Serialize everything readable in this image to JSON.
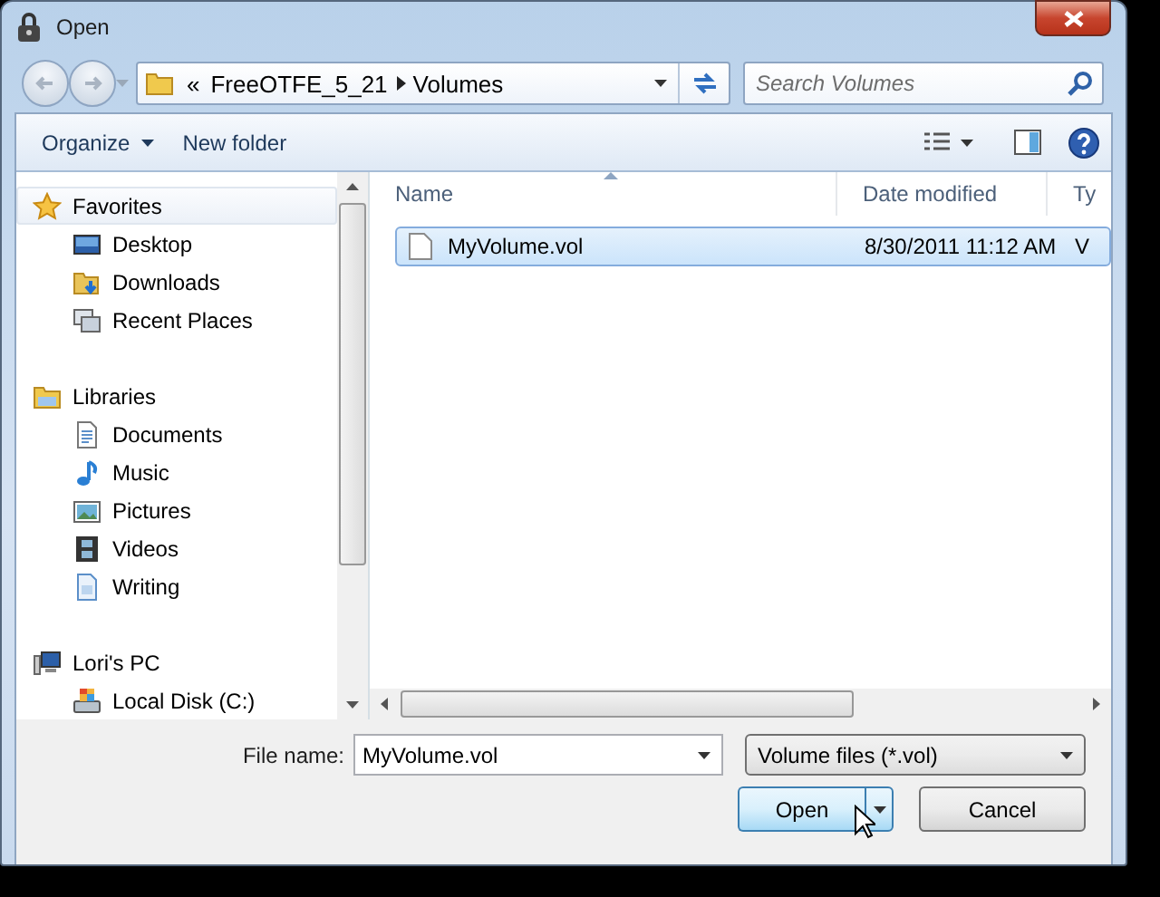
{
  "window": {
    "title": "Open"
  },
  "nav_buttons": [
    {
      "kind": "back",
      "disabled": true
    },
    {
      "kind": "forward",
      "disabled": true
    }
  ],
  "address": {
    "crumbs": [
      "«",
      "FreeOTFE_5_21",
      "Volumes"
    ]
  },
  "search": {
    "placeholder": "Search Volumes"
  },
  "toolbar": {
    "buttons": [
      {
        "label": "Organize",
        "dropdown": true
      },
      {
        "label": "New folder",
        "dropdown": false
      }
    ]
  },
  "navigation": [
    {
      "label": "Favorites",
      "selected": true,
      "children": [
        {
          "label": "Desktop",
          "selected": false
        },
        {
          "label": "Downloads",
          "selected": false
        },
        {
          "label": "Recent Places",
          "selected": false
        }
      ]
    },
    {
      "label": "Libraries",
      "selected": false,
      "children": [
        {
          "label": "Documents",
          "selected": false
        },
        {
          "label": "Music",
          "selected": false
        },
        {
          "label": "Pictures",
          "selected": false
        },
        {
          "label": "Videos",
          "selected": false
        },
        {
          "label": "Writing",
          "selected": false
        }
      ]
    },
    {
      "label": "Lori's PC",
      "selected": false,
      "children": [
        {
          "label": "Local Disk (C:)",
          "selected": false
        }
      ]
    }
  ],
  "files": {
    "columns": [
      {
        "label": "Name",
        "sorted": true
      },
      {
        "label": "Date modified",
        "sorted": false
      },
      {
        "label": "Ty",
        "sorted": false
      }
    ],
    "rows": [
      {
        "cells": [
          "MyVolume.vol",
          "8/30/2011 11:12 AM",
          "V"
        ],
        "selected": true
      }
    ]
  },
  "file_name": {
    "label": "File name:",
    "value": "MyVolume.vol"
  },
  "file_type": {
    "value": "Volume files (*.vol)"
  },
  "buttons": [
    {
      "label": "Open",
      "kind": "split",
      "hovered": true
    },
    {
      "label": "Cancel",
      "kind": "plain",
      "hovered": false
    }
  ]
}
